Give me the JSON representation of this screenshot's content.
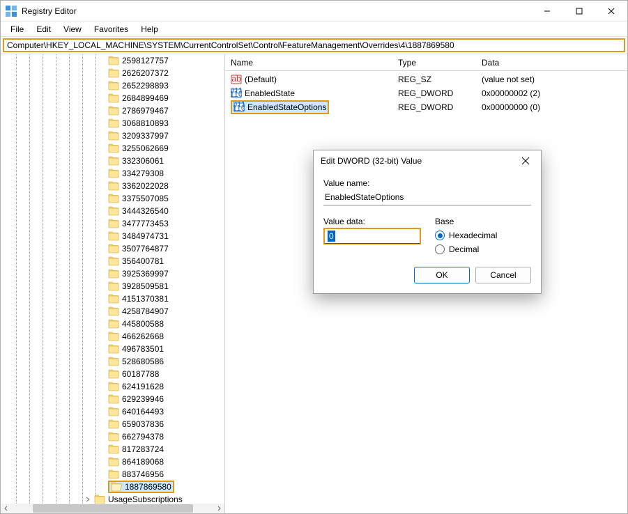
{
  "window": {
    "title": "Registry Editor"
  },
  "menu": {
    "file": "File",
    "edit": "Edit",
    "view": "View",
    "favorites": "Favorites",
    "help": "Help"
  },
  "address": "Computer\\HKEY_LOCAL_MACHINE\\SYSTEM\\CurrentControlSet\\Control\\FeatureManagement\\Overrides\\4\\1887869580",
  "tree": {
    "items": [
      "2598127757",
      "2626207372",
      "2652298893",
      "2684899469",
      "2786979467",
      "3068810893",
      "3209337997",
      "3255062669",
      "332306061",
      "334279308",
      "3362022028",
      "3375507085",
      "3444326540",
      "3477773453",
      "3484974731",
      "3507764877",
      "356400781",
      "3925369997",
      "3928509581",
      "4151370381",
      "4258784907",
      "445800588",
      "466262668",
      "496783501",
      "528680586",
      "60187788",
      "624191628",
      "629239946",
      "640164493",
      "659037836",
      "662794378",
      "817283724",
      "864189068",
      "883746956"
    ],
    "selected": "1887869580",
    "extra": "UsageSubscriptions"
  },
  "list": {
    "headers": {
      "name": "Name",
      "type": "Type",
      "data": "Data"
    },
    "rows": [
      {
        "icon": "sz",
        "name": "(Default)",
        "type": "REG_SZ",
        "data": "(value not set)",
        "selected": false
      },
      {
        "icon": "dw",
        "name": "EnabledState",
        "type": "REG_DWORD",
        "data": "0x00000002 (2)",
        "selected": false
      },
      {
        "icon": "dw",
        "name": "EnabledStateOptions",
        "type": "REG_DWORD",
        "data": "0x00000000 (0)",
        "selected": true
      }
    ]
  },
  "dialog": {
    "title": "Edit DWORD (32-bit) Value",
    "value_name_label": "Value name:",
    "value_name": "EnabledStateOptions",
    "value_data_label": "Value data:",
    "value_data": "0",
    "base_label": "Base",
    "hex_label": "Hexadecimal",
    "dec_label": "Decimal",
    "ok": "OK",
    "cancel": "Cancel"
  }
}
